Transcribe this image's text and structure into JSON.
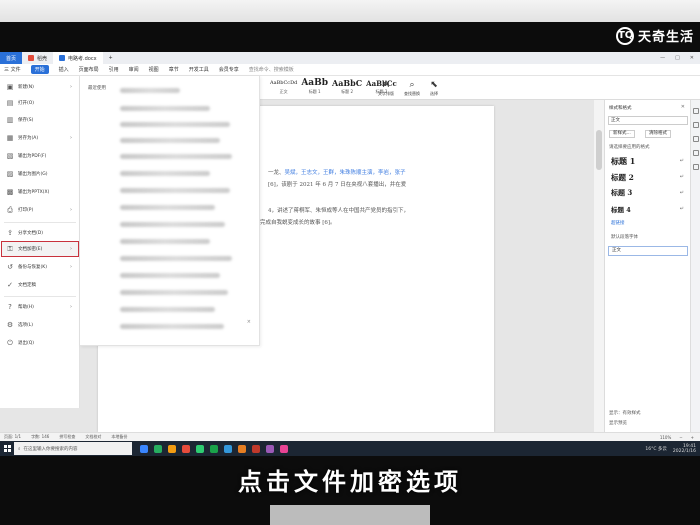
{
  "watermark": {
    "logo": "TQ",
    "text": "天奇生活",
    "corner_text": "天奇"
  },
  "caption": "点击文件加密选项",
  "titlebar": {
    "home": "首页",
    "tabs": [
      {
        "label": "稻壳",
        "color": "#e24b3b"
      },
      {
        "label": "电路考.docx",
        "color": "#2a70d8"
      }
    ],
    "add_tab": "+"
  },
  "ribbon_tabs": {
    "file": "三 文件",
    "start": "开始",
    "items": [
      "插入",
      "页面布局",
      "引用",
      "审阅",
      "视图",
      "章节",
      "开发工具",
      "会员专享"
    ],
    "search": "查找命令、搜索模板"
  },
  "styles_gallery": [
    {
      "sample": "AaBbCcDd",
      "name": "正文"
    },
    {
      "sample": "AaBb",
      "name": "标题 1"
    },
    {
      "sample": "AaBbC",
      "name": "标题 2"
    },
    {
      "sample": "AaBbCc",
      "name": "标题 3"
    }
  ],
  "ribbon_tools": [
    {
      "icon": "text-tools-icon",
      "glyph": "A",
      "label": "文字排版"
    },
    {
      "icon": "find-replace-icon",
      "glyph": "⌕",
      "label": "查找替换"
    },
    {
      "icon": "select-icon",
      "glyph": "⬉",
      "label": "选择"
    }
  ],
  "file_menu": {
    "items": [
      {
        "label": "新建(N)",
        "icon": "new-icon",
        "glyph": "▣",
        "arrow": true
      },
      {
        "label": "打开(O)",
        "icon": "open-icon",
        "glyph": "▤",
        "arrow": false
      },
      {
        "label": "保存(S)",
        "icon": "save-icon",
        "glyph": "▥",
        "arrow": false
      },
      {
        "label": "另存为(A)",
        "icon": "save-as-icon",
        "glyph": "▦",
        "arrow": true
      },
      {
        "label": "输出为PDF(F)",
        "icon": "pdf-icon",
        "glyph": "▧",
        "arrow": false
      },
      {
        "label": "输出为图片(G)",
        "icon": "image-icon",
        "glyph": "▨",
        "arrow": false
      },
      {
        "label": "输出为PPTX(X)",
        "icon": "pptx-icon",
        "glyph": "▩",
        "arrow": false
      },
      {
        "label": "打印(P)",
        "icon": "print-icon",
        "glyph": "⎙",
        "arrow": true
      },
      {
        "label": "分享文档(D)",
        "icon": "share-icon",
        "glyph": "⇪",
        "arrow": false
      },
      {
        "label": "文档加密(E)",
        "icon": "encrypt-icon",
        "glyph": "⚿",
        "arrow": true,
        "selected": true
      },
      {
        "label": "备份与恢复(K)",
        "icon": "backup-icon",
        "glyph": "↺",
        "arrow": true
      },
      {
        "label": "文档定稿",
        "icon": "finalize-icon",
        "glyph": "✓",
        "arrow": false
      },
      {
        "label": "帮助(H)",
        "icon": "help-icon",
        "glyph": "?",
        "arrow": true
      },
      {
        "label": "选项(L)",
        "icon": "options-icon",
        "glyph": "⚙",
        "arrow": false
      },
      {
        "label": "退出(Q)",
        "icon": "exit-icon",
        "glyph": "⏻",
        "arrow": false
      }
    ]
  },
  "recent_panel": {
    "title": "最近使用",
    "close": "×"
  },
  "document": {
    "line1": {
      "text_a": "一龙、",
      "names": "吴斌，王志文，王群，朱珠陈顺主演，李岩，张子"
    },
    "line2": "[6]，该剧于 2021 年 6 月 7 日在央视八套播出，并在爱",
    "line3": "4，讲述了蒋桐军、朱恒成等人在中国共产党员的指引下，",
    "line4": "完成自我蜕变成长的故事 [6]。"
  },
  "style_panel": {
    "title": "样式和格式",
    "current_style": "正文",
    "buttons": [
      "新样式...",
      "清除格式"
    ],
    "subtitle": "请选择要应用的格式",
    "styles": [
      "标题 1",
      "标题 2",
      "标题 3",
      "标题 4"
    ],
    "link1": "超链接",
    "link2": "默认段落字体",
    "selected": "正文",
    "show_label": "显示：有效样式",
    "preview_label": "显示预览"
  },
  "statusbar": {
    "page": "页面: 1/1",
    "words": "字数: 146",
    "spell": "拼写检查",
    "compat": "文档校对",
    "backup": "本地备份",
    "zoom": "110%"
  },
  "taskbar": {
    "search_placeholder": "在这里输入你要搜索的内容",
    "weather": "16°C 多云",
    "time": "19:41",
    "date": "2022/1/16",
    "app_colors": [
      "#3a86ff",
      "#27ae60",
      "#f39c12",
      "#e74c3c",
      "#2ecc71",
      "#1aa34a",
      "#3498db",
      "#e67e22",
      "#c0392b",
      "#9b59b6",
      "#e84393"
    ]
  }
}
